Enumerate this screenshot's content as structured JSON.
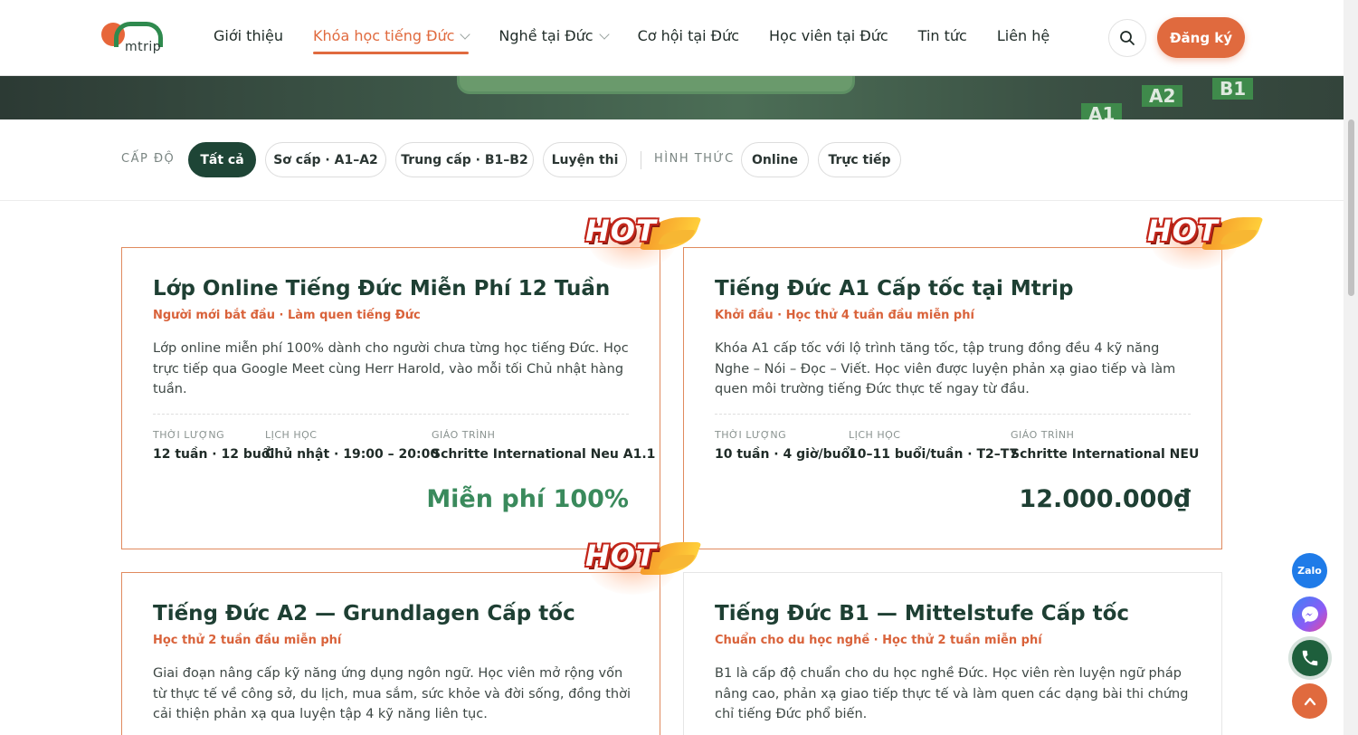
{
  "header": {
    "logo_text": "mtrip",
    "nav": [
      {
        "label": "Giới thiệu"
      },
      {
        "label": "Khóa học tiếng Đức"
      },
      {
        "label": "Nghề tại Đức"
      },
      {
        "label": "Cơ hội tại Đức"
      },
      {
        "label": "Học viên tại Đức"
      },
      {
        "label": "Tin tức"
      },
      {
        "label": "Liên hệ"
      }
    ],
    "active_nav": "Khóa học tiếng Đức",
    "register_label": "Đăng ký"
  },
  "banner": {
    "tiles": [
      "A1",
      "A2",
      "B1"
    ]
  },
  "filters": {
    "level_label": "CẤP ĐỘ",
    "level_chips": [
      "Tất cả",
      "Sơ cấp · A1–A2",
      "Trung cấp · B1–B2",
      "Luyện thi"
    ],
    "format_label": "HÌNH THỨC",
    "format_chips": [
      "Online",
      "Trực tiếp"
    ],
    "active_chip": "Tất cả"
  },
  "hot_label": "HOT",
  "cards": [
    {
      "hot": true,
      "title": "Lớp Online Tiếng Đức Miễn Phí 12 Tuần",
      "subtitle": "Người mới bắt đầu · Làm quen tiếng Đức",
      "description": "Lớp online miễn phí 100% dành cho người chưa từng học tiếng Đức. Học trực tiếp qua Google Meet cùng Herr Harold, vào mỗi tối Chủ nhật hàng tuần.",
      "meta": [
        {
          "label": "THỜI LƯỢNG",
          "value": "12 tuần · 12 buổi"
        },
        {
          "label": "LỊCH HỌC",
          "value": "Chủ nhật · 19:00 – 20:00"
        },
        {
          "label": "GIÁO TRÌNH",
          "value": "Schritte International Neu A1.1"
        }
      ],
      "price": "Miễn phí 100%"
    },
    {
      "hot": true,
      "title": "Tiếng Đức A1 Cấp tốc tại Mtrip",
      "subtitle": "Khởi đầu · Học thử 4 tuần đầu miễn phí",
      "description": "Khóa A1 cấp tốc với lộ trình tăng tốc, tập trung đồng đều 4 kỹ năng Nghe – Nói – Đọc – Viết. Học viên được luyện phản xạ giao tiếp và làm quen môi trường tiếng Đức thực tế ngay từ đầu.",
      "meta": [
        {
          "label": "THỜI LƯỢNG",
          "value": "10 tuần · 4 giờ/buổi"
        },
        {
          "label": "LỊCH HỌC",
          "value": "10–11 buổi/tuần · T2–T7"
        },
        {
          "label": "GIÁO TRÌNH",
          "value": "Schritte International NEU"
        }
      ],
      "price": "12.000.000₫"
    },
    {
      "hot": true,
      "title": "Tiếng Đức A2 — Grundlagen Cấp tốc",
      "subtitle": "Học thử 2 tuần đầu miễn phí",
      "description": "Giai đoạn nâng cấp kỹ năng ứng dụng ngôn ngữ. Học viên mở rộng vốn từ thực tế về công sở, du lịch, mua sắm, sức khỏe và đời sống, đồng thời cải thiện phản xạ qua luyện tập 4 kỹ năng liên tục."
    },
    {
      "hot": false,
      "title": "Tiếng Đức B1 — Mittelstufe Cấp tốc",
      "subtitle": "Chuẩn cho du học nghề · Học thử 2 tuần miễn phí",
      "description": "B1 là cấp độ chuẩn cho du học nghề Đức. Học viên rèn luyện ngữ pháp nâng cao, phản xạ giao tiếp thực tế và làm quen các dạng bài thi chứng chỉ tiếng Đức phổ biến."
    }
  ],
  "floating": {
    "zalo_label": "Zalo"
  },
  "colors": {
    "accent": "#e06a3e",
    "brand_green": "#1e4536",
    "price_green": "#3a8a5c"
  }
}
